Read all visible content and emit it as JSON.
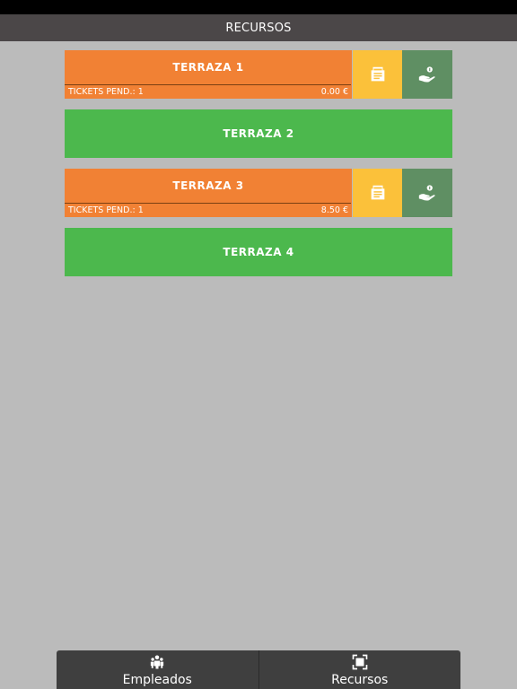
{
  "header": {
    "title": "RECURSOS"
  },
  "resources": [
    {
      "name": "TERRAZA 1",
      "status": "busy",
      "pending_label": "TICKETS PEND.: 1",
      "amount": "0.00 €"
    },
    {
      "name": "TERRAZA 2",
      "status": "free"
    },
    {
      "name": "TERRAZA 3",
      "status": "busy",
      "pending_label": "TICKETS PEND.: 1",
      "amount": "8.50 €"
    },
    {
      "name": "TERRAZA 4",
      "status": "free"
    }
  ],
  "icons": {
    "ticket_action": "receipt-icon",
    "pay_action": "hand-coin-icon",
    "tab_employees": "people-icon",
    "tab_resources": "frame-icon"
  },
  "tabs": [
    {
      "label": "Empleados",
      "icon": "people-icon"
    },
    {
      "label": "Recursos",
      "icon": "frame-icon"
    }
  ],
  "colors": {
    "header_bg": "#4b4748",
    "busy": "#f18134",
    "free": "#4cb84d",
    "ticket_action": "#fbc13a",
    "pay_action": "#5f8f63",
    "tabbar_bg": "#3f3f3f"
  }
}
